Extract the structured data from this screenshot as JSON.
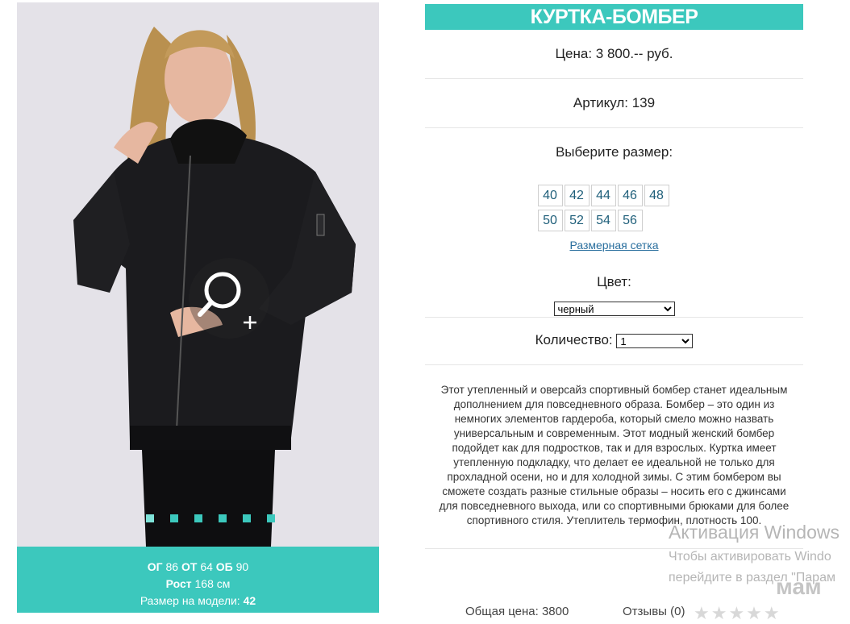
{
  "product": {
    "title": "КУРТКА-БОМБЕР",
    "price": "Цена: 3 800.-- руб.",
    "sku": "Артикул: 139",
    "size_label": "Выберите размер:",
    "sizes": [
      "40",
      "42",
      "44",
      "46",
      "48",
      "50",
      "52",
      "54",
      "56"
    ],
    "size_chart_link": "Размерная сетка",
    "color_label": "Цвет:",
    "color_selected": "черный",
    "quantity_label": "Количество:",
    "quantity_selected": "1",
    "description": "Этот утепленный и оверсайз спортивный бомбер станет идеальным дополнением для повседневного образа. Бомбер – это один из немногих элементов гардероба, который смело можно назвать универсальным и современным. Этот модный женский бомбер подойдет как для подростков, так и для взрослых. Куртка имеет утепленную подкладку, что делает ее идеальной не только для прохладной осени, но и для холодной зимы. С этим бомбером вы сможете создать разные стильные образы – носить его с джинсами для повседневного выхода, или со спортивными брюками для более спортивного стиля. Утеплитель термофин, плотность 100.",
    "total_label": "Общая цена: 3800",
    "reviews_label": "Отзывы (0)",
    "stars": "★★★★★"
  },
  "model": {
    "og_label": "ОГ",
    "og_value": "86",
    "ot_label": "ОТ",
    "ot_value": "64",
    "ob_label": "ОБ",
    "ob_value": "90",
    "height_label": "Рост",
    "height_value": "168 см",
    "size_label": "Размер на модели:",
    "size_value": "42"
  },
  "gallery": {
    "slide_count": 6,
    "active_slide": 1
  },
  "watermark": {
    "line1": "Активация Windows",
    "line2": "Чтобы активировать Windo",
    "line3": "перейдите в раздел \"Парам",
    "logo": "мам"
  },
  "colors": {
    "accent": "#3cc8bd",
    "link": "#2a6f9e",
    "size_text": "#1f5f7a"
  }
}
